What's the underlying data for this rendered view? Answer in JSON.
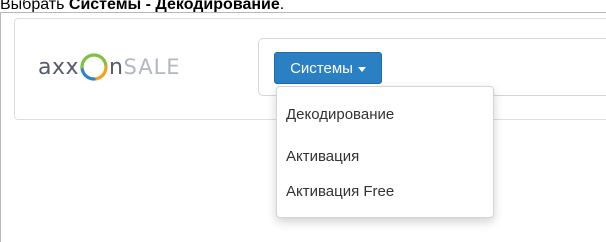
{
  "caption": {
    "prefix": "Выбрать ",
    "bold": "Системы - Декодирование",
    "suffix": "."
  },
  "logo": {
    "text_left": "axx",
    "text_mid": "n",
    "text_right": "SALE",
    "colors": {
      "dark": "#545b6b",
      "light": "#b3b8c0",
      "ring_green": "#7dc242",
      "ring_orange": "#f6a01a",
      "ring_blue": "#2a86c8"
    }
  },
  "navbar": {
    "systems_button": {
      "label": "Системы",
      "icon": "caret-down-icon",
      "color": "#2b7fc3"
    }
  },
  "dropdown": {
    "items": [
      {
        "label": "Декодирование"
      },
      {
        "label": "Активация"
      },
      {
        "label": "Активация Free"
      }
    ]
  }
}
